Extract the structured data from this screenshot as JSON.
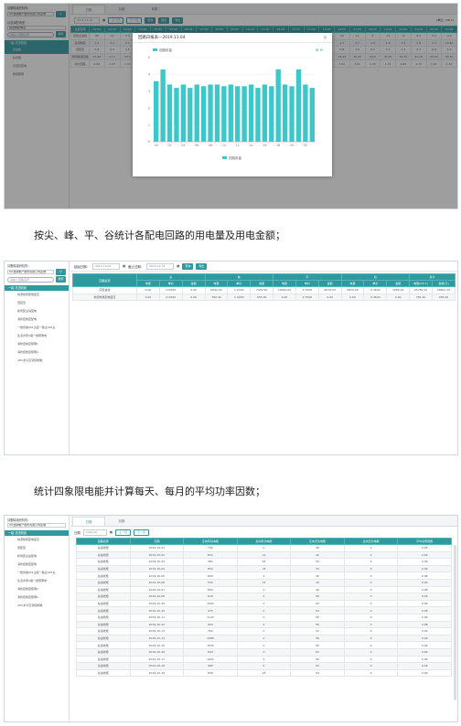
{
  "caption1": "按尖、峰、平、谷统计各配电回路的用电量及用电金额；",
  "caption2": "统计四象限电能并计算每天、每月的平均功率因数；",
  "sidebar": {
    "label_company": "请删除组织机构：",
    "company": "XX冶铜制产限份有限公司区域",
    "label_station": "请选择配电室：",
    "station": "综合楼配电室",
    "search_placeholder": "请输入回路名称",
    "search_btn": "搜索",
    "root": "一级 总进线柜",
    "items1": [
      "总进线",
      "综合楼",
      "高低压配电",
      "楼层照明"
    ],
    "items2": [
      "地源热泵配电变压",
      "低配室",
      "新增配主站配电",
      "消防控制室配电",
      "一楼食堂AP1主变一路主AP1主",
      "生活水泵C路一楼照明电",
      "消防控制室照明1",
      "消防控制室照明2",
      "AHC水冷空调控制箱"
    ]
  },
  "s1": {
    "tabs": [
      "日报",
      "月报",
      "年报"
    ],
    "date": "2019-11-04",
    "prev": "上一日",
    "next": "下一日",
    "query": "查询",
    "chart_btn": "图表",
    "export": "导出",
    "unit_label": "(单位：kW·h)",
    "headers": [
      "位置名称",
      "00:00",
      "01:00",
      "02:00",
      "03:00",
      "04:00",
      "05:00",
      "06:00",
      "07:00",
      "08:00",
      "09:00",
      "10:00",
      "11:00",
      "12:00",
      "13:00",
      "14:00",
      "15:00",
      "16:00",
      "17:00",
      "18:00",
      "19:00",
      "20:00",
      "21:00",
      "22:00",
      "23:00"
    ],
    "rows": [
      [
        "宗控主进线",
        "96",
        "12",
        "4.3",
        "3.5",
        "3.7",
        "4.1",
        "4.0",
        "6.2",
        "10.4",
        "11",
        "13",
        "9.9",
        "9.5",
        "12",
        "83",
        "12",
        "10",
        "12",
        "9",
        "11",
        "12",
        "4.4",
        "3.3",
        "4.4"
      ],
      [
        "总控制室",
        "1.2",
        "0.2",
        "0.1",
        "0.1",
        "0.2",
        "0.1",
        "0.2",
        "0.4",
        "0.6",
        "0.5",
        "0.6",
        "1.6",
        "1.5",
        "1.6",
        "1.6",
        "1.7",
        "1.7",
        "1.7",
        "1.6",
        "1.9",
        "1.5",
        "1.6",
        "1.7",
        "10.40"
      ],
      [
        "低配室",
        "0.5",
        "0.2",
        "0.1",
        "0.1",
        "0.1",
        "0.1",
        "0.1",
        "0.3",
        "0.4",
        "0.5",
        "0.6",
        "0.5",
        "0.8",
        "0.6",
        "0.8",
        "0.7",
        "0.8",
        "1.0",
        "0.9",
        "0.7",
        "1.2",
        "1.1",
        "0.9",
        "1.0"
      ],
      [
        "照明插座回路",
        "27.10",
        "17.1",
        "12.3",
        "10.3",
        "13.5",
        "13.3",
        "14.2",
        "19.3",
        "21.1",
        "23.1",
        "22.1",
        "20.6",
        "21.5",
        "20.8",
        "22.0",
        "20.0",
        "32.44",
        "30.20",
        "30.2",
        "32.10",
        "32.33",
        "21.70",
        "23.10",
        "44.10"
      ],
      [
        "动力回路",
        "0.93",
        "1.53",
        "1.24",
        "1.32",
        "1.55",
        "1.73",
        "1.81",
        "1.58",
        "2.04",
        "1.85",
        "1.7",
        "1.83",
        "1.44",
        "1.53",
        "1.5",
        "1.74",
        "1.52",
        "1.61",
        "1.74",
        "1.79",
        "1.82",
        "1.73",
        "1.91",
        "1.40"
      ]
    ],
    "modal_title": "回路日报表—2019.11.04",
    "legend": "回路用量"
  },
  "chart_data": {
    "type": "bar",
    "title": "回路日报表—2019.11.04",
    "categories": [
      "00",
      "01",
      "02",
      "03",
      "04",
      "05",
      "06",
      "07",
      "08",
      "09",
      "10",
      "11",
      "12",
      "13",
      "14",
      "15",
      "16",
      "17",
      "18",
      "19",
      "20",
      "21",
      "22",
      "23"
    ],
    "series": [
      {
        "name": "回路用量",
        "values": [
          3.6,
          4.3,
          3.4,
          3.2,
          3.4,
          3.2,
          3.4,
          3.3,
          3.4,
          3.4,
          3.3,
          3.4,
          3.3,
          3.3,
          3.4,
          3.2,
          3.4,
          3.3,
          4.3,
          3.4,
          3.3,
          4.3,
          3.4,
          3.2
        ]
      }
    ],
    "ylim": [
      0,
      5
    ],
    "yticks": [
      "0",
      "1",
      "2",
      "3",
      "4",
      "5"
    ],
    "color": "#3cc7c9"
  },
  "s2": {
    "start_label": "起始日期：",
    "start": "2019-10-01",
    "end_label": "截止日期：",
    "end": "2019-10-31",
    "query": "查询",
    "export": "导出",
    "groups": [
      "尖",
      "峰",
      "平",
      "谷",
      "总计"
    ],
    "sub": [
      "电量",
      "单价",
      "金额"
    ],
    "tot_sub": [
      "电量(kW·h)",
      "金额(元)"
    ],
    "first_col": "回路名称",
    "rows": [
      [
        "宗控进线",
        "0.00",
        "0.0000",
        "0.00",
        "6090.00",
        "1.2220",
        "7432.00",
        "10020.00",
        "0.7500",
        "6576.04",
        "3870.00",
        "0.3640",
        "3280.00",
        "25780.00",
        "18601.10"
      ],
      [
        "地源热泵配电变压",
        "0.00",
        "0.0000",
        "0.00",
        "782.40",
        "1.3220",
        "935.00",
        "0.00",
        "0.7500",
        "0.00",
        "0.00",
        "0.3640",
        "0.00",
        "782.40",
        "935.00"
      ]
    ]
  },
  "s3": {
    "tabs": [
      "日报",
      "月报"
    ],
    "date_label": "日期",
    "date": "2019-10",
    "prev": "上一月",
    "next": "下一月",
    "headers": [
      "回路名称",
      "日期",
      "正向有功电能",
      "反向有功电能",
      "正向无功电能",
      "反向无功电能",
      "平均功率因数"
    ],
    "rows": [
      [
        "总进线柜",
        "2019-10-01",
        "746",
        "0",
        "46",
        "0",
        "0.96"
      ],
      [
        "总进线柜",
        "2019-10-02",
        "810",
        "14",
        "42",
        "2",
        "0.99"
      ],
      [
        "总进线柜",
        "2019-10-03",
        "482",
        "58",
        "55",
        "4",
        "0.99"
      ],
      [
        "总进线柜",
        "2019-10-04",
        "852",
        "16",
        "43",
        "0",
        "0.99"
      ],
      [
        "总进线柜",
        "2019-10-05",
        "650",
        "4",
        "36",
        "0",
        "0.96"
      ],
      [
        "总进线柜",
        "2019-10-06",
        "550",
        "15",
        "39",
        "0",
        "0.99"
      ],
      [
        "总进线柜",
        "2019-10-07",
        "856",
        "0",
        "40",
        "0",
        "0.98"
      ],
      [
        "总进线柜",
        "2019-10-08",
        "618",
        "0",
        "56",
        "0",
        "0.99"
      ],
      [
        "总进线柜",
        "2019-10-09",
        "1093",
        "0",
        "50",
        "0",
        "0.96"
      ],
      [
        "总进线柜",
        "2019-10-10",
        "975",
        "0",
        "54",
        "0",
        "0.98"
      ],
      [
        "总进线柜",
        "2019-10-11",
        "1143",
        "0",
        "56",
        "0",
        "0.99"
      ],
      [
        "总进线柜",
        "2019-10-12",
        "964",
        "0",
        "56",
        "0",
        "0.98"
      ],
      [
        "总进线柜",
        "2019-10-13",
        "762",
        "0",
        "52",
        "0",
        "0.99"
      ],
      [
        "总进线柜",
        "2019-10-14",
        "1088",
        "0",
        "56",
        "0",
        "0.99"
      ],
      [
        "总进线柜",
        "2019-10-15",
        "1034",
        "0",
        "56",
        "0",
        "0.99"
      ],
      [
        "总进线柜",
        "2019-10-16",
        "844",
        "0",
        "52",
        "0",
        "0.99"
      ],
      [
        "总进线柜",
        "2019-10-17",
        "1022",
        "0",
        "56",
        "0",
        "0.99"
      ],
      [
        "总进线柜",
        "2019-10-18",
        "968",
        "0",
        "54",
        "0",
        "0.99"
      ],
      [
        "总进线柜",
        "2019-10-19",
        "826",
        "16",
        "54",
        "0",
        "0.99"
      ]
    ]
  }
}
